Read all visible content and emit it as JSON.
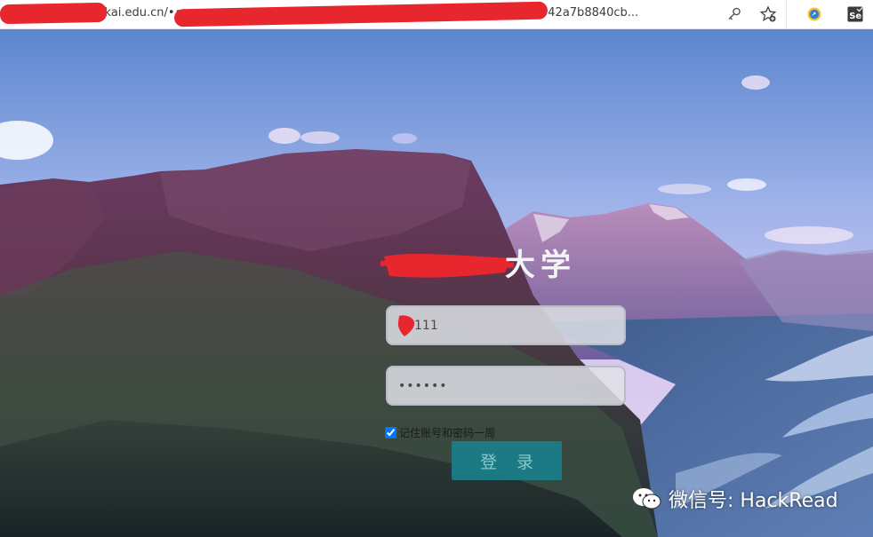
{
  "browser": {
    "url_text": "https://•••••.nankai.edu.cn/•••••••••••••••••••••••••••••••••••••••f4d43300688a293542a7b8840cb..."
  },
  "login": {
    "school_name_visible": "大学",
    "username_value": "111",
    "password_value": "••••••",
    "remember_label": "记住账号和密码一周",
    "remember_checked": true,
    "login_button_label": "登 录"
  },
  "watermark": {
    "text": "微信号: HackRead"
  },
  "colors": {
    "button_bg": "#1a7f8a",
    "button_text": "#8fd3d7",
    "redaction": "#e8262e",
    "field_border": "#b8bcc7"
  },
  "icons": [
    "key-icon",
    "favorites-star-icon",
    "browser-extension-icon",
    "selenium-icon",
    "wechat-icon"
  ]
}
